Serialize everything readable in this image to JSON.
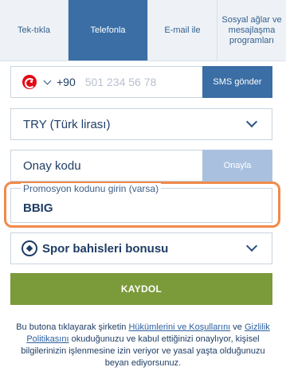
{
  "tabs": [
    {
      "label": "Tek-tıkla",
      "active": false
    },
    {
      "label": "Telefonla",
      "active": true
    },
    {
      "label": "E-mail ile",
      "active": false
    },
    {
      "label": "Sosyal ağlar ve mesajlaşma programları",
      "active": false
    }
  ],
  "phone": {
    "country_icon": "turkey-flag-icon",
    "prefix": "+90",
    "placeholder": "501 234 56 78",
    "sms_button": "SMS gönder"
  },
  "currency": {
    "value": "TRY (Türk lirası)",
    "icon": "chevron-down-icon"
  },
  "confirmation": {
    "label": "Onay kodu",
    "button": "Onayla"
  },
  "promo": {
    "label": "Promosyon kodunu girin (varsa)",
    "value": "BBIG",
    "highlight_color": "#f08a4b"
  },
  "bonus": {
    "icon": "soccer-ball-icon",
    "label": "Spor bahisleri bonusu"
  },
  "register": {
    "label": "KAYDOL",
    "color": "#7b9a3a"
  },
  "terms": {
    "t1": "Bu butona tıklayarak şirketin ",
    "link1": "Hükümlerini ve Koşullarını",
    "t2": " ve ",
    "link2": "Gizlilik Politikasını",
    "t3": " okuduğunuzu ve kabul ettiğinizi onaylıyor, kişisel bilgilerinizin işlenmesine izin veriyor ve yasal yaşta olduğunuzu beyan ediyorsunuz."
  },
  "colors": {
    "accent": "#3a6ea5",
    "text": "#1f3d66",
    "disabled_button": "#a9c1df"
  }
}
